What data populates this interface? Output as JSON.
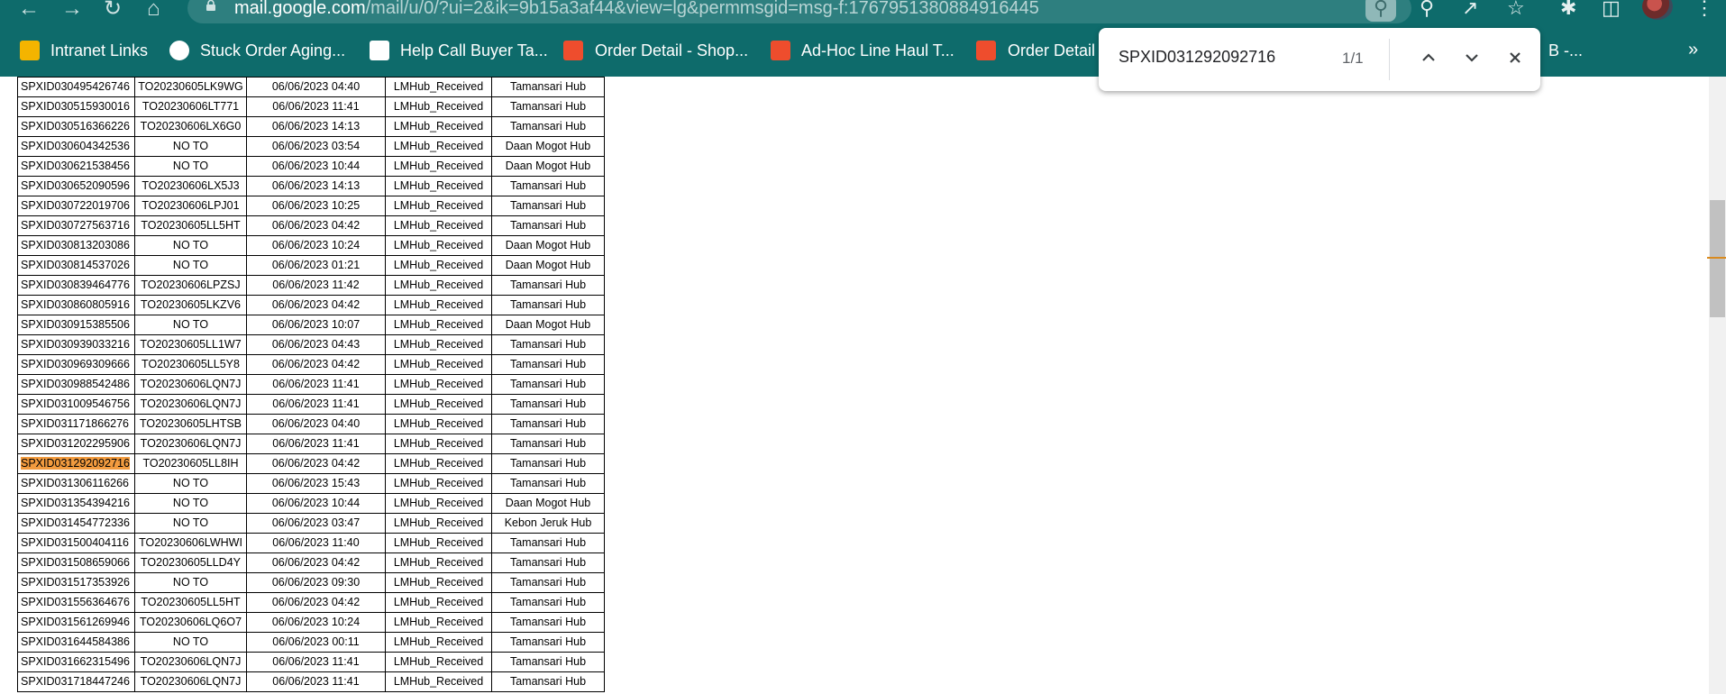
{
  "browser": {
    "url_host": "mail.google.com",
    "url_path": "/mail/u/0/?ui=2&ik=9b15a3af44&view=lg&permmsgid=msg-f:1767951380884916445"
  },
  "bookmarks": [
    {
      "label": "Intranet Links",
      "icon": "doc-icon",
      "color": "#f4b400"
    },
    {
      "label": "Stuck Order Aging...",
      "icon": "google-icon",
      "color": "#ffffff"
    },
    {
      "label": "Help Call Buyer Ta...",
      "icon": "gmail-icon",
      "color": "#ea4335"
    },
    {
      "label": "Order Detail - Shop...",
      "icon": "shopee-icon",
      "color": "#ee4d2d"
    },
    {
      "label": "Ad-Hoc Line Haul T...",
      "icon": "shopee-icon",
      "color": "#ee4d2d"
    },
    {
      "label": "Order Detail",
      "icon": "shopee-icon",
      "color": "#ee4d2d"
    },
    {
      "label": "B -...",
      "icon": "",
      "color": ""
    }
  ],
  "find": {
    "query": "SPXID031292092716",
    "count": "1/1"
  },
  "rows": [
    [
      "SPXID030495426746",
      "TO20230605LK9WG",
      "06/06/2023 04:40",
      "LMHub_Received",
      "Tamansari Hub"
    ],
    [
      "SPXID030515930016",
      "TO20230606LT771",
      "06/06/2023 11:41",
      "LMHub_Received",
      "Tamansari Hub"
    ],
    [
      "SPXID030516366226",
      "TO20230606LX6G0",
      "06/06/2023 14:13",
      "LMHub_Received",
      "Tamansari Hub"
    ],
    [
      "SPXID030604342536",
      "NO TO",
      "06/06/2023 03:54",
      "LMHub_Received",
      "Daan Mogot Hub"
    ],
    [
      "SPXID030621538456",
      "NO TO",
      "06/06/2023 10:44",
      "LMHub_Received",
      "Daan Mogot Hub"
    ],
    [
      "SPXID030652090596",
      "TO20230606LX5J3",
      "06/06/2023 14:13",
      "LMHub_Received",
      "Tamansari Hub"
    ],
    [
      "SPXID030722019706",
      "TO20230606LPJ01",
      "06/06/2023 10:25",
      "LMHub_Received",
      "Tamansari Hub"
    ],
    [
      "SPXID030727563716",
      "TO20230605LL5HT",
      "06/06/2023 04:42",
      "LMHub_Received",
      "Tamansari Hub"
    ],
    [
      "SPXID030813203086",
      "NO TO",
      "06/06/2023 10:24",
      "LMHub_Received",
      "Daan Mogot Hub"
    ],
    [
      "SPXID030814537026",
      "NO TO",
      "06/06/2023 01:21",
      "LMHub_Received",
      "Daan Mogot Hub"
    ],
    [
      "SPXID030839464776",
      "TO20230606LPZSJ",
      "06/06/2023 11:42",
      "LMHub_Received",
      "Tamansari Hub"
    ],
    [
      "SPXID030860805916",
      "TO20230605LKZV6",
      "06/06/2023 04:42",
      "LMHub_Received",
      "Tamansari Hub"
    ],
    [
      "SPXID030915385506",
      "NO TO",
      "06/06/2023 10:07",
      "LMHub_Received",
      "Daan Mogot Hub"
    ],
    [
      "SPXID030939033216",
      "TO20230605LL1W7",
      "06/06/2023 04:43",
      "LMHub_Received",
      "Tamansari Hub"
    ],
    [
      "SPXID030969309666",
      "TO20230605LL5Y8",
      "06/06/2023 04:42",
      "LMHub_Received",
      "Tamansari Hub"
    ],
    [
      "SPXID030988542486",
      "TO20230606LQN7J",
      "06/06/2023 11:41",
      "LMHub_Received",
      "Tamansari Hub"
    ],
    [
      "SPXID031009546756",
      "TO20230606LQN7J",
      "06/06/2023 11:41",
      "LMHub_Received",
      "Tamansari Hub"
    ],
    [
      "SPXID031171866276",
      "TO20230605LHTSB",
      "06/06/2023 04:40",
      "LMHub_Received",
      "Tamansari Hub"
    ],
    [
      "SPXID031202295906",
      "TO20230606LQN7J",
      "06/06/2023 11:41",
      "LMHub_Received",
      "Tamansari Hub"
    ],
    [
      "SPXID031292092716",
      "TO20230605LL8IH",
      "06/06/2023 04:42",
      "LMHub_Received",
      "Tamansari Hub"
    ],
    [
      "SPXID031306116266",
      "NO TO",
      "06/06/2023 15:43",
      "LMHub_Received",
      "Tamansari Hub"
    ],
    [
      "SPXID031354394216",
      "NO TO",
      "06/06/2023 10:44",
      "LMHub_Received",
      "Daan Mogot Hub"
    ],
    [
      "SPXID031454772336",
      "NO TO",
      "06/06/2023 03:47",
      "LMHub_Received",
      "Kebon Jeruk Hub"
    ],
    [
      "SPXID031500404116",
      "TO20230606LWHWI",
      "06/06/2023 11:40",
      "LMHub_Received",
      "Tamansari Hub"
    ],
    [
      "SPXID031508659066",
      "TO20230605LLD4Y",
      "06/06/2023 04:42",
      "LMHub_Received",
      "Tamansari Hub"
    ],
    [
      "SPXID031517353926",
      "NO TO",
      "06/06/2023 09:30",
      "LMHub_Received",
      "Tamansari Hub"
    ],
    [
      "SPXID031556364676",
      "TO20230605LL5HT",
      "06/06/2023 04:42",
      "LMHub_Received",
      "Tamansari Hub"
    ],
    [
      "SPXID031561269946",
      "TO20230606LQ6O7",
      "06/06/2023 10:24",
      "LMHub_Received",
      "Tamansari Hub"
    ],
    [
      "SPXID031644584386",
      "NO TO",
      "06/06/2023 00:11",
      "LMHub_Received",
      "Tamansari Hub"
    ],
    [
      "SPXID031662315496",
      "TO20230606LQN7J",
      "06/06/2023 11:41",
      "LMHub_Received",
      "Tamansari Hub"
    ],
    [
      "SPXID031718447246",
      "TO20230606LQN7J",
      "06/06/2023 11:41",
      "LMHub_Received",
      "Tamansari Hub"
    ]
  ],
  "highlight_row_index": 19,
  "colors": {
    "chrome_bg": "#0e6b6b",
    "highlight": "#f29b3f"
  }
}
